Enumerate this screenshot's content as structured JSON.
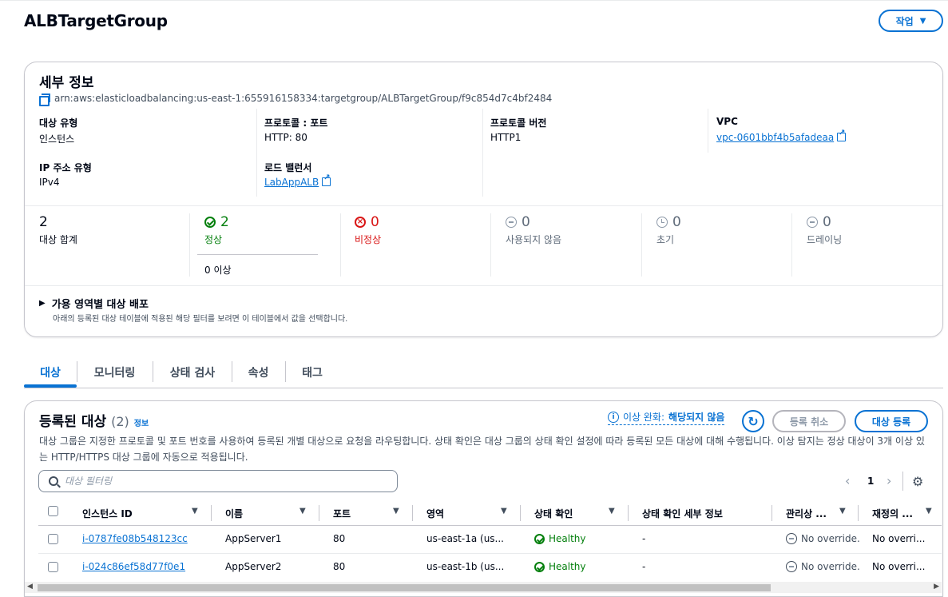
{
  "page": {
    "title": "ALBTargetGroup",
    "actions_label": "작업"
  },
  "details": {
    "heading": "세부 정보",
    "arn": "arn:aws:elasticloadbalancing:us-east-1:655916158334:targetgroup/ALBTargetGroup/f9c854d7c4bf2484",
    "fields": {
      "target_type_label": "대상 유형",
      "target_type_value": "인스턴스",
      "protocol_port_label": "프로토콜 : 포트",
      "protocol_port_value": "HTTP: 80",
      "protocol_version_label": "프로토콜 버전",
      "protocol_version_value": "HTTP1",
      "vpc_label": "VPC",
      "vpc_value": "vpc-0601bbf4b5afadeaa",
      "ip_type_label": "IP 주소 유형",
      "ip_type_value": "IPv4",
      "lb_label": "로드 밸런서",
      "lb_value": "LabAppALB"
    },
    "stats": {
      "total_num": "2",
      "total_label": "대상 합계",
      "healthy_num": "2",
      "healthy_label": "정상",
      "healthy_sub": "0 이상",
      "unhealthy_num": "0",
      "unhealthy_label": "비정상",
      "unused_num": "0",
      "unused_label": "사용되지 않음",
      "initial_num": "0",
      "initial_label": "초기",
      "draining_num": "0",
      "draining_label": "드레이닝"
    },
    "az_section": {
      "title": "가용 영역별 대상 배포",
      "description": "아래의 등록된 대상 테이블에 적용된 해당 필터를 보려면 이 테이블에서 값을 선택합니다."
    }
  },
  "tabs": [
    {
      "label": "대상"
    },
    {
      "label": "모니터링"
    },
    {
      "label": "상태 검사"
    },
    {
      "label": "속성"
    },
    {
      "label": "태그"
    }
  ],
  "targets": {
    "heading": "등록된 대상",
    "count": "(2)",
    "info_label": "정보",
    "anomaly_label": "이상 완화:",
    "anomaly_value": "해당되지 않음",
    "deregister_label": "등록 취소",
    "register_label": "대상 등록",
    "description": "대상 그룹은 지정한 프로토콜 및 포트 번호를 사용하여 등록된 개별 대상으로 요청을 라우팅합니다. 상태 확인은 대상 그룹의 상태 확인 설정에 따라 등록된 모든 대상에 대해 수행됩니다. 이상 탐지는 정상 대상이 3개 이상 있는 HTTP/HTTPS 대상 그룹에 자동으로 적용됩니다.",
    "filter_placeholder": "대상 필터링",
    "page_number": "1",
    "columns": {
      "instance_id": "인스턴스 ID",
      "name": "이름",
      "port": "포트",
      "zone": "영역",
      "health": "상태 확인",
      "health_detail": "상태 확인 세부 정보",
      "admin": "관리상 ...",
      "reassign": "재정의 ..."
    },
    "rows": [
      {
        "instance_id": "i-0787fe08b548123cc",
        "name": "AppServer1",
        "port": "80",
        "zone": "us-east-1a (us...",
        "health": "Healthy",
        "detail": "-",
        "admin": "No override.",
        "reassign": "No overri..."
      },
      {
        "instance_id": "i-024c86ef58d77f0e1",
        "name": "AppServer2",
        "port": "80",
        "zone": "us-east-1b (us...",
        "health": "Healthy",
        "detail": "-",
        "admin": "No override.",
        "reassign": "No overri..."
      }
    ]
  },
  "colors": {
    "accent": "#0972d3",
    "success": "#037f0c",
    "error": "#d91515",
    "muted": "#5f6b7a"
  }
}
